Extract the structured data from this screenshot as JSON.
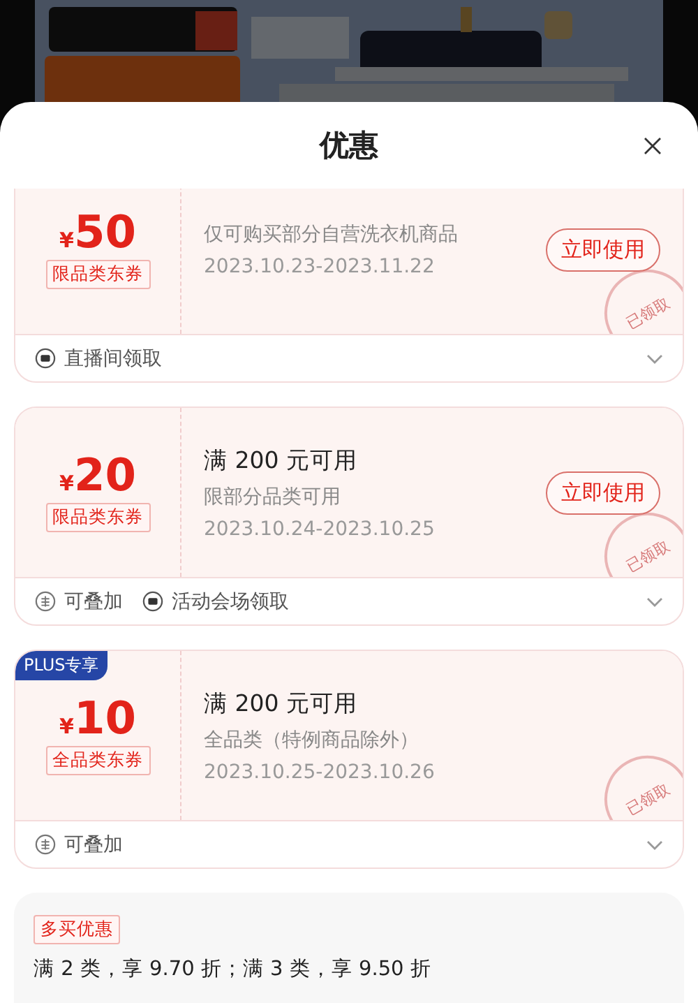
{
  "sheet": {
    "title": "优惠"
  },
  "coupons": [
    {
      "currency": "¥",
      "amount": "50",
      "tag": "限品类东券",
      "desc": "仅可购买部分自营洗衣机商品",
      "dates": "2023.10.23-2023.11.22",
      "button": "立即使用",
      "stamp": "已领取",
      "footer": [
        {
          "kind": "claim",
          "text": "直播间领取"
        }
      ]
    },
    {
      "currency": "¥",
      "amount": "20",
      "tag": "限品类东券",
      "title": "满 200 元可用",
      "desc": "限部分品类可用",
      "dates": "2023.10.24-2023.10.25",
      "button": "立即使用",
      "stamp": "已领取",
      "footer": [
        {
          "kind": "stack",
          "text": "可叠加"
        },
        {
          "kind": "claim",
          "text": "活动会场领取"
        }
      ]
    },
    {
      "badge": "PLUS专享",
      "currency": "¥",
      "amount": "10",
      "tag": "全品类东券",
      "title": "满 200 元可用",
      "desc": "全品类（特例商品除外）",
      "dates": "2023.10.25-2023.10.26",
      "stamp": "已领取",
      "footer": [
        {
          "kind": "stack",
          "text": "可叠加"
        }
      ]
    }
  ],
  "promo": {
    "tag": "多买优惠",
    "text": "满 2 类，享 9.70 折；满 3 类，享 9.50 折"
  }
}
